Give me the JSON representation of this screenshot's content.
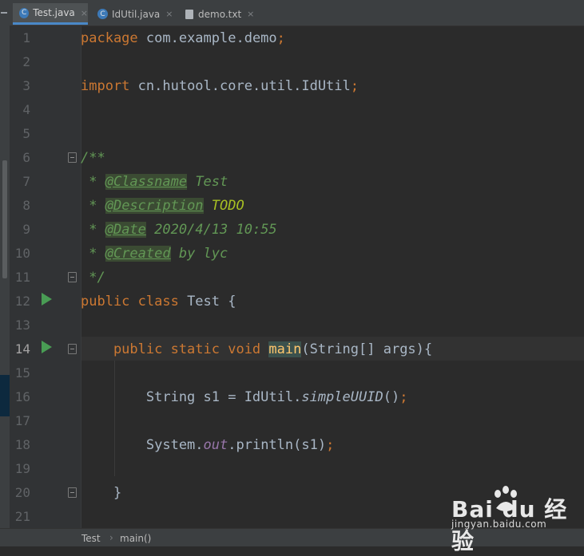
{
  "tabs": [
    {
      "label": "Test.java",
      "icon": "java-class-icon",
      "active": true
    },
    {
      "label": "IdUtil.java",
      "icon": "java-class-icon",
      "active": false
    },
    {
      "label": "demo.txt",
      "icon": "text-file-icon",
      "active": false
    }
  ],
  "tab_close_glyph": "×",
  "lines": [
    {
      "n": "1"
    },
    {
      "n": "2"
    },
    {
      "n": "3"
    },
    {
      "n": "4"
    },
    {
      "n": "5"
    },
    {
      "n": "6"
    },
    {
      "n": "7"
    },
    {
      "n": "8"
    },
    {
      "n": "9"
    },
    {
      "n": "10"
    },
    {
      "n": "11"
    },
    {
      "n": "12"
    },
    {
      "n": "13"
    },
    {
      "n": "14"
    },
    {
      "n": "15"
    },
    {
      "n": "16"
    },
    {
      "n": "17"
    },
    {
      "n": "18"
    },
    {
      "n": "19"
    },
    {
      "n": "20"
    },
    {
      "n": "21"
    }
  ],
  "code": {
    "l1": {
      "kw": "package",
      "rest": " com.example.demo",
      "semi": ";"
    },
    "l3": {
      "kw": "import",
      "rest": " cn.hutool.core.util.IdUtil",
      "semi": ";"
    },
    "l6": {
      "text": "/**"
    },
    "l7": {
      "star": " * ",
      "tag": "@Classname",
      "val": " Test"
    },
    "l8": {
      "star": " * ",
      "tag": "@Description",
      "val": " TODO"
    },
    "l9": {
      "star": " * ",
      "tag": "@Date",
      "val": " 2020/4/13 10:55"
    },
    "l10": {
      "star": " * ",
      "tag": "@Created",
      "val": " by lyc"
    },
    "l11": {
      "text": " */"
    },
    "l12": {
      "kw": "public class",
      "rest": " Test {"
    },
    "l14": {
      "kw": "    public static void",
      "sp": " ",
      "fn": "main",
      "rest": "(String[] args){"
    },
    "l16": {
      "pre": "        String s1 = IdUtil.",
      "sfn": "simpleUUID",
      "rest": "()",
      "semi": ";"
    },
    "l18": {
      "pre": "        System.",
      "fld": "out",
      "rest": ".println(s1)",
      "semi": ";"
    },
    "l20": {
      "text": "    }"
    }
  },
  "breadcrumb": [
    "Test",
    "main()"
  ],
  "breadcrumb_sep": "›",
  "watermark": {
    "logo": "Bai du 经验",
    "url": "jingyan.baidu.com"
  },
  "colors": {
    "keyword": "#cc7832",
    "comment": "#629755",
    "todo": "#a8c023",
    "method": "#ffc66d",
    "field": "#9876aa",
    "text": "#a9b7c6",
    "run": "#499c54"
  }
}
